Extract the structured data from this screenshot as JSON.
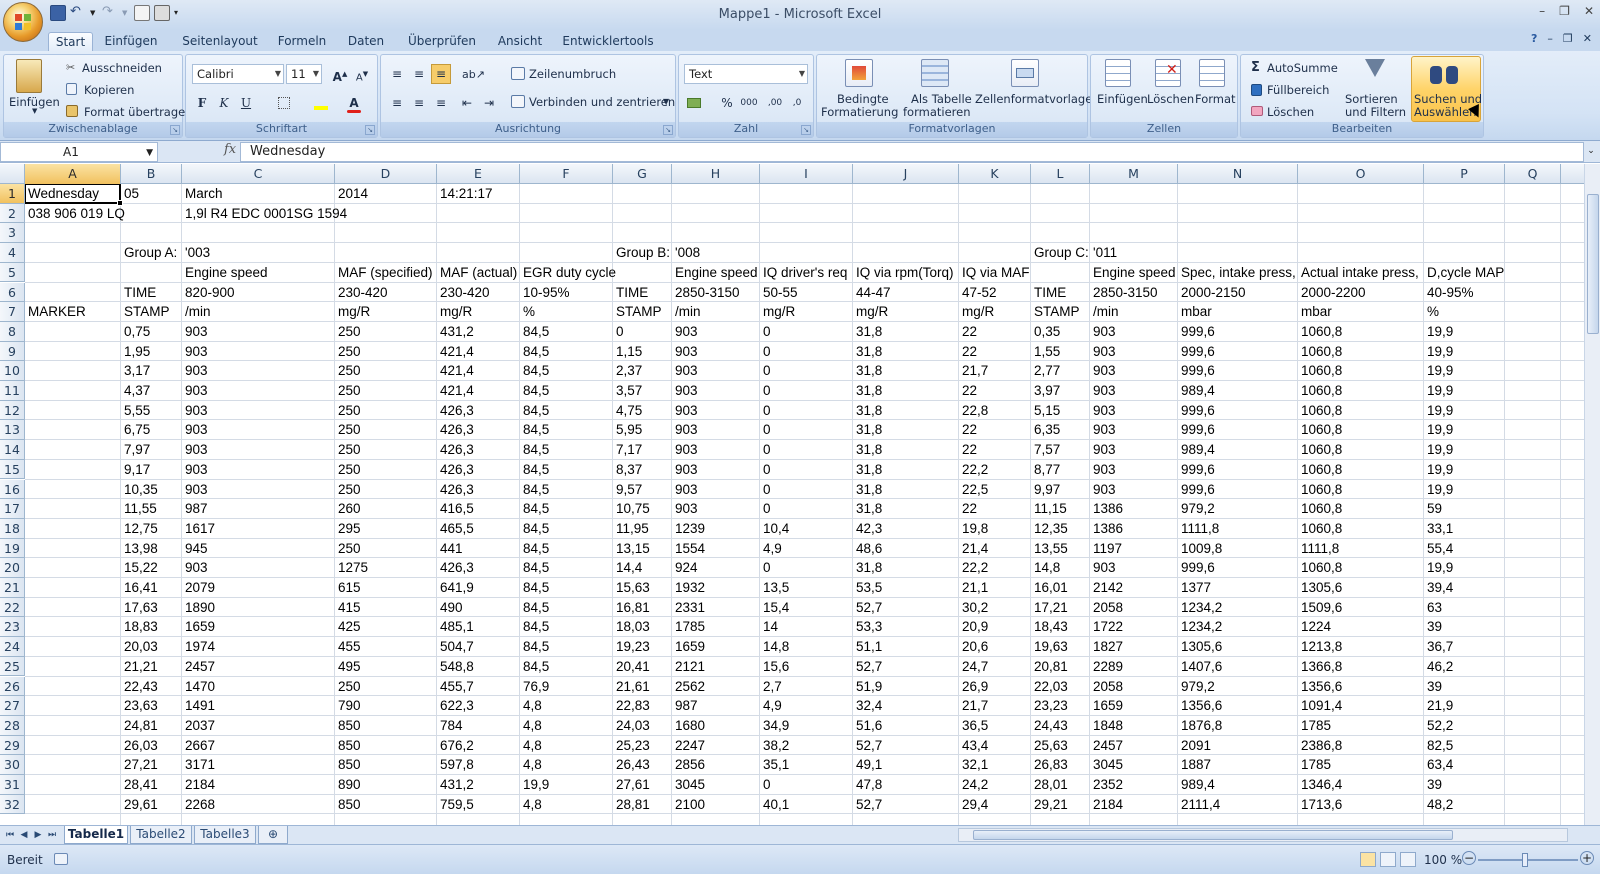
{
  "window": {
    "title": "Mappe1 - Microsoft Excel",
    "minimize": "–",
    "restore": "❐",
    "close": "✕"
  },
  "ribbon_tabs": [
    "Start",
    "Einfügen",
    "Seitenlayout",
    "Formeln",
    "Daten",
    "Überprüfen",
    "Ansicht",
    "Entwicklertools"
  ],
  "active_tab": "Start",
  "groups": {
    "zwischenablage": {
      "label": "Zwischenablage",
      "einfuegen": "Einfügen",
      "ausschneiden": "Ausschneiden",
      "kopieren": "Kopieren",
      "format_uebertragen": "Format übertragen"
    },
    "schriftart": {
      "label": "Schriftart",
      "font": "Calibri",
      "size": "11",
      "bold": "F",
      "italic": "K",
      "underline": "U",
      "font_color_letter": "A"
    },
    "ausrichtung": {
      "label": "Ausrichtung",
      "zeilenumbruch": "Zeilenumbruch",
      "verbinden": "Verbinden und zentrieren"
    },
    "zahl": {
      "label": "Zahl",
      "format": "Text",
      "percent": "%",
      "thousands": "000"
    },
    "formatvorlagen": {
      "label": "Formatvorlagen",
      "bedingte_1": "Bedingte",
      "bedingte_2": "Formatierung",
      "als_tabelle_1": "Als Tabelle",
      "als_tabelle_2": "formatieren",
      "zellenformat": "Zellenformatvorlagen"
    },
    "zellen": {
      "label": "Zellen",
      "einfuegen": "Einfügen",
      "loeschen": "Löschen",
      "format": "Format"
    },
    "bearbeiten": {
      "label": "Bearbeiten",
      "autosumme": "AutoSumme",
      "fuellbereich": "Füllbereich",
      "loeschen": "Löschen",
      "sortieren_1": "Sortieren",
      "sortieren_2": "und Filtern",
      "suchen_1": "Suchen und",
      "suchen_2": "Auswählen"
    }
  },
  "formula_bar": {
    "name_box": "A1",
    "fx": "fx",
    "value": "Wednesday"
  },
  "columns": [
    "A",
    "B",
    "C",
    "D",
    "E",
    "F",
    "G",
    "H",
    "I",
    "J",
    "K",
    "L",
    "M",
    "N",
    "O",
    "P",
    "Q"
  ],
  "rows": [
    [
      "Wednesday",
      "05",
      "March",
      "2014",
      "14:21:17",
      "",
      "",
      "",
      "",
      "",
      "",
      "",
      "",
      "",
      "",
      "",
      ""
    ],
    [
      "038 906 019 LQ",
      "",
      "1,9l R4 EDC 0001SG  1594",
      "",
      "",
      "",
      "",
      "",
      "",
      "",
      "",
      "",
      "",
      "",
      "",
      "",
      ""
    ],
    [
      "",
      "",
      "",
      "",
      "",
      "",
      "",
      "",
      "",
      "",
      "",
      "",
      "",
      "",
      "",
      "",
      ""
    ],
    [
      "",
      "Group A:",
      "'003",
      "",
      "",
      "",
      "Group B:",
      "'008",
      "",
      "",
      "",
      "Group C:",
      "'011",
      "",
      "",
      "",
      ""
    ],
    [
      "",
      "",
      "Engine speed",
      "MAF (specified)",
      "MAF (actual)",
      "EGR duty cycle",
      "",
      "Engine speed",
      "IQ driver's req",
      "IQ via rpm(Torq)",
      "IQ via MAF",
      "",
      "Engine speed",
      "Spec, intake press,",
      "Actual intake press,",
      "D,cycle MAP",
      ""
    ],
    [
      "",
      "TIME",
      "820-900",
      "230-420",
      "230-420",
      "10-95%",
      "TIME",
      "2850-3150",
      "50-55",
      "44-47",
      "47-52",
      "TIME",
      "2850-3150",
      "2000-2150",
      "2000-2200",
      "40-95%",
      ""
    ],
    [
      "MARKER",
      "STAMP",
      "/min",
      "mg/R",
      "mg/R",
      "%",
      "STAMP",
      "/min",
      "mg/R",
      "mg/R",
      "mg/R",
      "STAMP",
      "/min",
      "mbar",
      "mbar",
      "%",
      ""
    ],
    [
      "",
      "0,75",
      "903",
      "250",
      "431,2",
      "84,5",
      "0",
      "903",
      "0",
      "31,8",
      "22",
      "0,35",
      "903",
      "999,6",
      "1060,8",
      "19,9",
      ""
    ],
    [
      "",
      "1,95",
      "903",
      "250",
      "421,4",
      "84,5",
      "1,15",
      "903",
      "0",
      "31,8",
      "22",
      "1,55",
      "903",
      "999,6",
      "1060,8",
      "19,9",
      ""
    ],
    [
      "",
      "3,17",
      "903",
      "250",
      "421,4",
      "84,5",
      "2,37",
      "903",
      "0",
      "31,8",
      "21,7",
      "2,77",
      "903",
      "999,6",
      "1060,8",
      "19,9",
      ""
    ],
    [
      "",
      "4,37",
      "903",
      "250",
      "421,4",
      "84,5",
      "3,57",
      "903",
      "0",
      "31,8",
      "22",
      "3,97",
      "903",
      "989,4",
      "1060,8",
      "19,9",
      ""
    ],
    [
      "",
      "5,55",
      "903",
      "250",
      "426,3",
      "84,5",
      "4,75",
      "903",
      "0",
      "31,8",
      "22,8",
      "5,15",
      "903",
      "999,6",
      "1060,8",
      "19,9",
      ""
    ],
    [
      "",
      "6,75",
      "903",
      "250",
      "426,3",
      "84,5",
      "5,95",
      "903",
      "0",
      "31,8",
      "22",
      "6,35",
      "903",
      "999,6",
      "1060,8",
      "19,9",
      ""
    ],
    [
      "",
      "7,97",
      "903",
      "250",
      "426,3",
      "84,5",
      "7,17",
      "903",
      "0",
      "31,8",
      "22",
      "7,57",
      "903",
      "989,4",
      "1060,8",
      "19,9",
      ""
    ],
    [
      "",
      "9,17",
      "903",
      "250",
      "426,3",
      "84,5",
      "8,37",
      "903",
      "0",
      "31,8",
      "22,2",
      "8,77",
      "903",
      "999,6",
      "1060,8",
      "19,9",
      ""
    ],
    [
      "",
      "10,35",
      "903",
      "250",
      "426,3",
      "84,5",
      "9,57",
      "903",
      "0",
      "31,8",
      "22,5",
      "9,97",
      "903",
      "999,6",
      "1060,8",
      "19,9",
      ""
    ],
    [
      "",
      "11,55",
      "987",
      "260",
      "416,5",
      "84,5",
      "10,75",
      "903",
      "0",
      "31,8",
      "22",
      "11,15",
      "1386",
      "979,2",
      "1060,8",
      "59",
      ""
    ],
    [
      "",
      "12,75",
      "1617",
      "295",
      "465,5",
      "84,5",
      "11,95",
      "1239",
      "10,4",
      "42,3",
      "19,8",
      "12,35",
      "1386",
      "1111,8",
      "1060,8",
      "33,1",
      ""
    ],
    [
      "",
      "13,98",
      "945",
      "250",
      "441",
      "84,5",
      "13,15",
      "1554",
      "4,9",
      "48,6",
      "21,4",
      "13,55",
      "1197",
      "1009,8",
      "1111,8",
      "55,4",
      ""
    ],
    [
      "",
      "15,22",
      "903",
      "1275",
      "426,3",
      "84,5",
      "14,4",
      "924",
      "0",
      "31,8",
      "22,2",
      "14,8",
      "903",
      "999,6",
      "1060,8",
      "19,9",
      ""
    ],
    [
      "",
      "16,41",
      "2079",
      "615",
      "641,9",
      "84,5",
      "15,63",
      "1932",
      "13,5",
      "53,5",
      "21,1",
      "16,01",
      "2142",
      "1377",
      "1305,6",
      "39,4",
      ""
    ],
    [
      "",
      "17,63",
      "1890",
      "415",
      "490",
      "84,5",
      "16,81",
      "2331",
      "15,4",
      "52,7",
      "30,2",
      "17,21",
      "2058",
      "1234,2",
      "1509,6",
      "63",
      ""
    ],
    [
      "",
      "18,83",
      "1659",
      "425",
      "485,1",
      "84,5",
      "18,03",
      "1785",
      "14",
      "53,3",
      "20,9",
      "18,43",
      "1722",
      "1234,2",
      "1224",
      "39",
      ""
    ],
    [
      "",
      "20,03",
      "1974",
      "455",
      "504,7",
      "84,5",
      "19,23",
      "1659",
      "14,8",
      "51,1",
      "20,6",
      "19,63",
      "1827",
      "1305,6",
      "1213,8",
      "36,7",
      ""
    ],
    [
      "",
      "21,21",
      "2457",
      "495",
      "548,8",
      "84,5",
      "20,41",
      "2121",
      "15,6",
      "52,7",
      "24,7",
      "20,81",
      "2289",
      "1407,6",
      "1366,8",
      "46,2",
      ""
    ],
    [
      "",
      "22,43",
      "1470",
      "250",
      "455,7",
      "76,9",
      "21,61",
      "2562",
      "2,7",
      "51,9",
      "26,9",
      "22,03",
      "2058",
      "979,2",
      "1356,6",
      "39",
      ""
    ],
    [
      "",
      "23,63",
      "1491",
      "790",
      "622,3",
      "4,8",
      "22,83",
      "987",
      "4,9",
      "32,4",
      "21,7",
      "23,23",
      "1659",
      "1356,6",
      "1091,4",
      "21,9",
      ""
    ],
    [
      "",
      "24,81",
      "2037",
      "850",
      "784",
      "4,8",
      "24,03",
      "1680",
      "34,9",
      "51,6",
      "36,5",
      "24,43",
      "1848",
      "1876,8",
      "1785",
      "52,2",
      ""
    ],
    [
      "",
      "26,03",
      "2667",
      "850",
      "676,2",
      "4,8",
      "25,23",
      "2247",
      "38,2",
      "52,7",
      "43,4",
      "25,63",
      "2457",
      "2091",
      "2386,8",
      "82,5",
      ""
    ],
    [
      "",
      "27,21",
      "3171",
      "850",
      "597,8",
      "4,8",
      "26,43",
      "2856",
      "35,1",
      "49,1",
      "32,1",
      "26,83",
      "3045",
      "1887",
      "1785",
      "63,4",
      ""
    ],
    [
      "",
      "28,41",
      "2184",
      "890",
      "431,2",
      "19,9",
      "27,61",
      "3045",
      "0",
      "47,8",
      "24,2",
      "28,01",
      "2352",
      "989,4",
      "1346,4",
      "39",
      ""
    ],
    [
      "",
      "29,61",
      "2268",
      "850",
      "759,5",
      "4,8",
      "28,81",
      "2100",
      "40,1",
      "52,7",
      "29,4",
      "29,21",
      "2184",
      "2111,4",
      "1713,6",
      "48,2",
      ""
    ]
  ],
  "sheet_tabs": [
    "Tabelle1",
    "Tabelle2",
    "Tabelle3"
  ],
  "active_sheet": "Tabelle1",
  "status": {
    "text": "Bereit",
    "zoom": "100 %"
  }
}
